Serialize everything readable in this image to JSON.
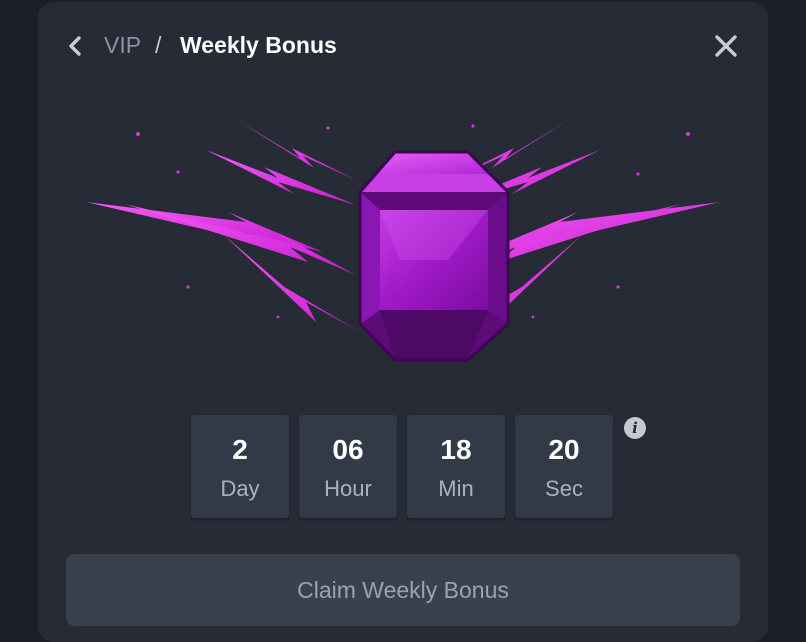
{
  "header": {
    "breadcrumb_parent": "VIP",
    "breadcrumb_separator": "/",
    "breadcrumb_current": "Weekly Bonus"
  },
  "icons": {
    "back": "chevron-left-icon",
    "close": "close-icon",
    "info": "info-icon",
    "hero": "gem-with-lightning"
  },
  "timer": [
    {
      "value": "2",
      "unit": "Day"
    },
    {
      "value": "06",
      "unit": "Hour"
    },
    {
      "value": "18",
      "unit": "Min"
    },
    {
      "value": "20",
      "unit": "Sec"
    }
  ],
  "info_glyph": "i",
  "claim_button_label": "Claim Weekly Bonus",
  "colors": {
    "background": "#1b1f27",
    "modal": "#262b36",
    "timer_box": "#333a47",
    "button_disabled": "#3a404c",
    "gem": "#b21fd6",
    "lightning": "#e231e6"
  }
}
